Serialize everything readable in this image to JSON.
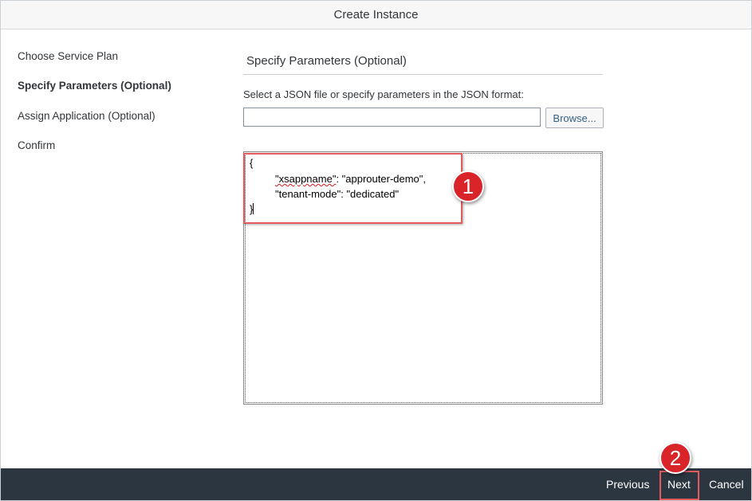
{
  "dialog": {
    "title": "Create Instance"
  },
  "steps": [
    {
      "label": "Choose Service Plan"
    },
    {
      "label": "Specify Parameters (Optional)"
    },
    {
      "label": "Assign Application (Optional)"
    },
    {
      "label": "Confirm"
    }
  ],
  "section": {
    "title": "Specify Parameters (Optional)",
    "instruction": "Select a JSON file or specify parameters in the JSON format:"
  },
  "file_input": {
    "value": "",
    "browse_label": "Browse..."
  },
  "json_editor": {
    "line1": "{",
    "key1": "\"xsappname\"",
    "value1": ": \"approuter-demo\",",
    "line3": "\"tenant-mode\": \"dedicated\"",
    "line4": "}"
  },
  "callouts": {
    "one": "1",
    "two": "2"
  },
  "footer": {
    "previous": "Previous",
    "next": "Next",
    "cancel": "Cancel"
  },
  "colors": {
    "footer_bg": "#2c3640",
    "callout_red": "#d9242a",
    "highlight_red": "#e35b5b",
    "link_blue": "#346187"
  }
}
